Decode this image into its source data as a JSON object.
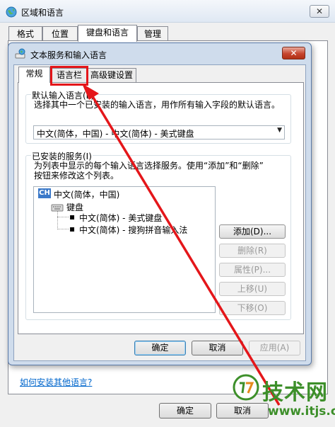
{
  "outer_window": {
    "title": "区域和语言",
    "close_glyph": "✕",
    "tabs": [
      "格式",
      "位置",
      "键盘和语言",
      "管理"
    ],
    "selected_tab": "键盘和语言",
    "link_text": "如何安装其他语言?",
    "buttons": {
      "ok": "确定",
      "cancel": "取消"
    }
  },
  "dialog": {
    "title": "文本服务和输入语言",
    "close_glyph": "✕",
    "tabs": [
      "常规",
      "语言栏",
      "高级键设置"
    ],
    "selected_tab": "常规",
    "default_language": {
      "group_title": "默认输入语言(L)",
      "description": "选择其中一个已安装的输入语言，用作所有输入字段的默认语言。",
      "selected_value": "中文(简体，中国) - 中文(简体) - 美式键盘"
    },
    "installed_services": {
      "group_title": "已安装的服务(I)",
      "description_line1": "为列表中显示的每个输入语言选择服务。使用“添加”和“删除”",
      "description_line2": "按钮来修改这个列表。",
      "language_badge": "CH",
      "language": "中文(简体，中国)",
      "category": "键盘",
      "services": [
        "中文(简体) - 美式键盘",
        "中文(简体) - 搜狗拼音输入法"
      ]
    },
    "side_buttons": {
      "add": "添加(D)...",
      "remove": "删除(R)",
      "properties": "属性(P)...",
      "move_up": "上移(U)",
      "move_down": "下移(O)"
    },
    "bottom_buttons": {
      "ok": "确定",
      "cancel": "取消",
      "apply": "应用(A)"
    }
  },
  "annotation": {
    "color": "#e4161a"
  },
  "watermark": {
    "name": "技术网",
    "url": "www.itjs.cn",
    "color": "#3d8f2a"
  }
}
